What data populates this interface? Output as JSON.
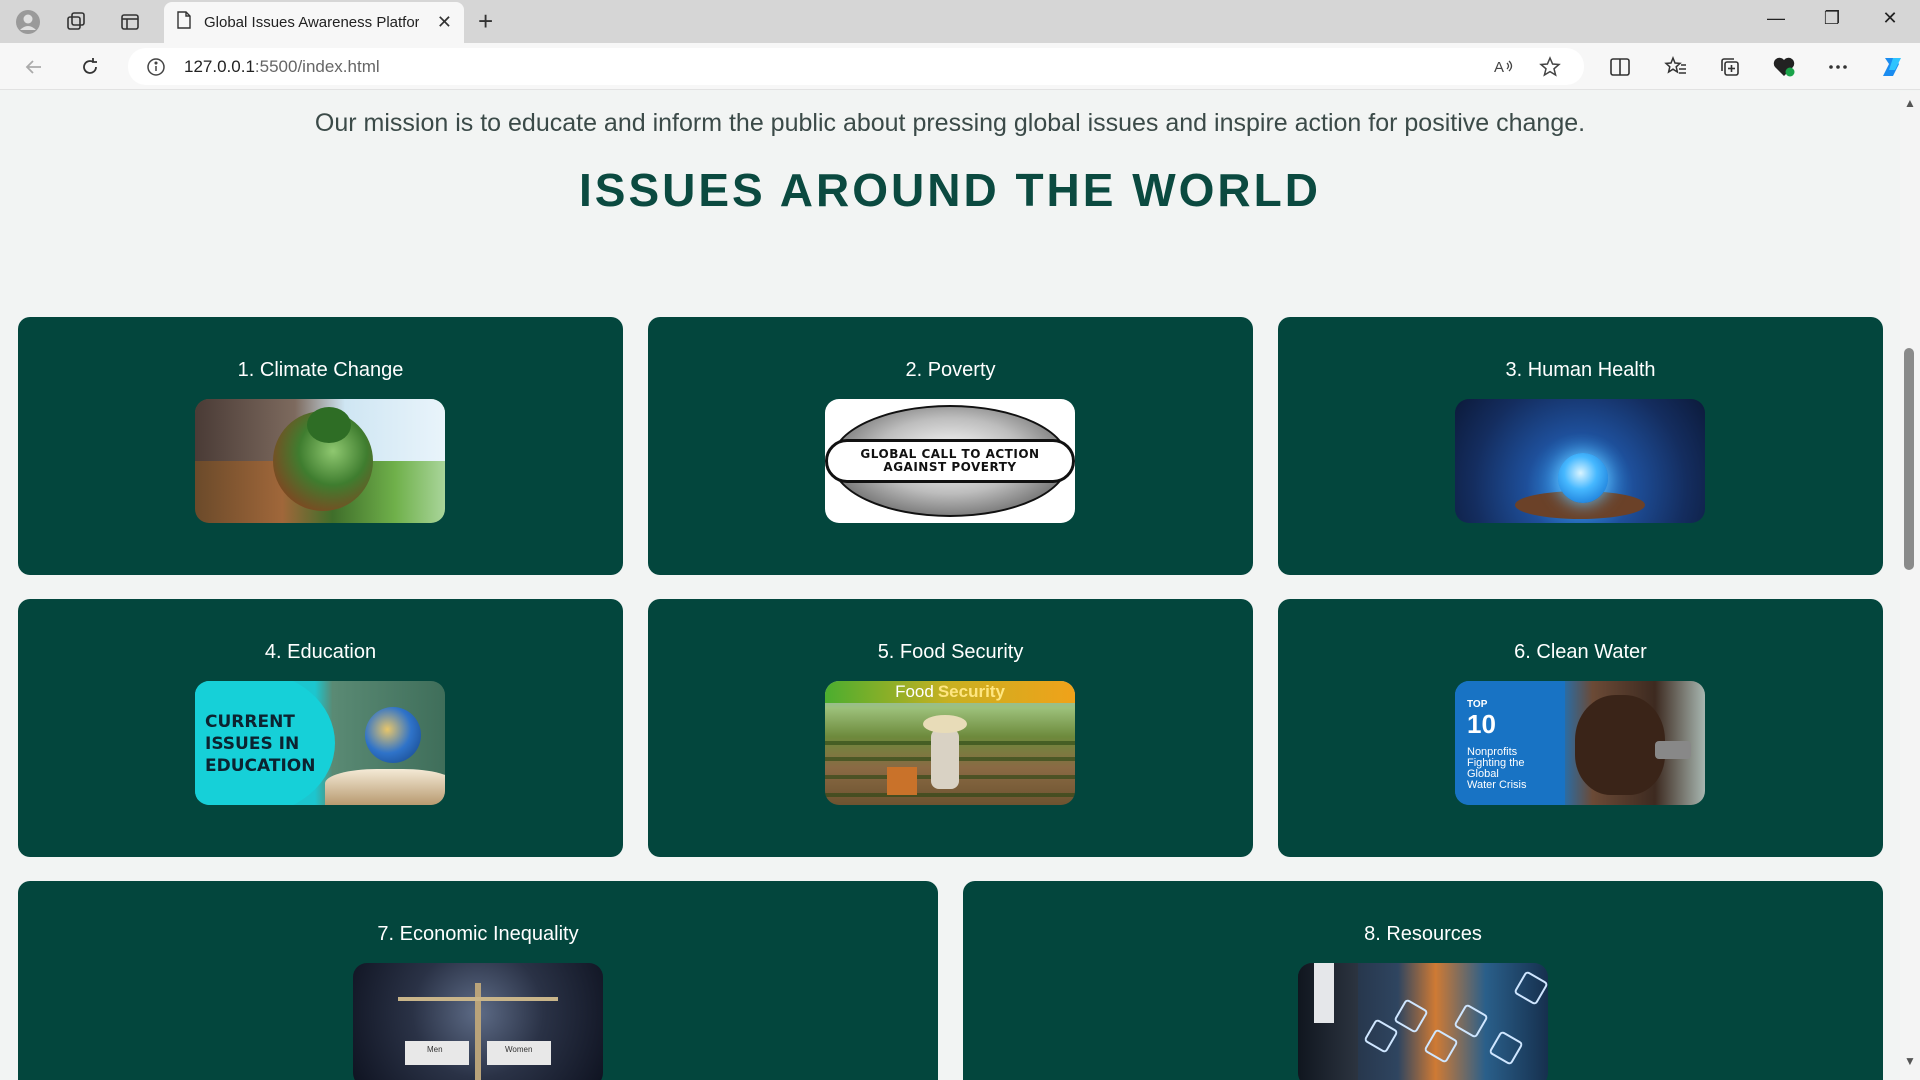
{
  "browser": {
    "tab_title": "Global Issues Awareness Platform",
    "url_host": "127.0.0.1",
    "url_path": ":5500/index.html"
  },
  "page": {
    "mission": "Our mission is to educate and inform the public about pressing global issues and inspire action for positive change.",
    "heading": "ISSUES AROUND THE WORLD"
  },
  "issues": [
    {
      "title": "1. Climate Change"
    },
    {
      "title": "2. Poverty",
      "image_text": [
        "GLOBAL CALL TO ACTION",
        "AGAINST POVERTY"
      ]
    },
    {
      "title": "3. Human Health"
    },
    {
      "title": "4. Education",
      "image_text": [
        "CURRENT",
        "ISSUES IN",
        "EDUCATION"
      ]
    },
    {
      "title": "5. Food Security",
      "image_text": [
        "Food",
        "Security"
      ]
    },
    {
      "title": "6. Clean Water",
      "image_text": [
        "TOP",
        "10",
        "Nonprofits",
        "Fighting the",
        "Global",
        "Water Crisis"
      ]
    },
    {
      "title": "7. Economic Inequality",
      "image_text": [
        "Men",
        "Women"
      ]
    },
    {
      "title": "8. Resources"
    }
  ],
  "colors": {
    "card_bg": "#03463d",
    "heading": "#0b4a40",
    "page_bg": "#f2f4f3"
  }
}
